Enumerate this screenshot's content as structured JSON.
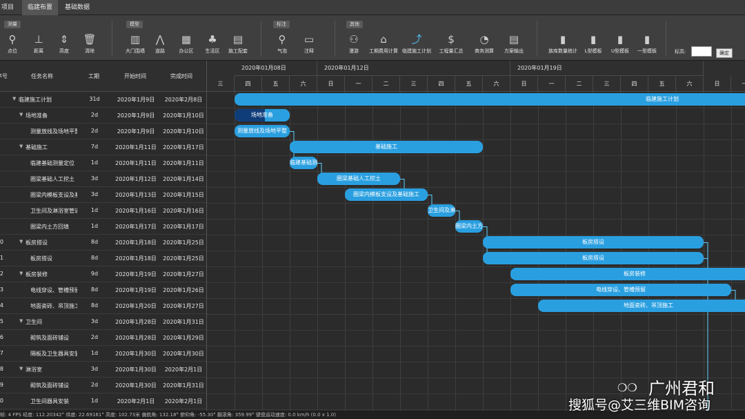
{
  "menu": [
    "项目",
    "临建布置",
    "基础数据"
  ],
  "toolbar": {
    "groups": [
      "测量",
      "模型",
      "标注",
      "其他"
    ],
    "tools": [
      {
        "label": "点位",
        "icon": "location-pin-icon",
        "glyph": "⚲"
      },
      {
        "label": "距离",
        "icon": "ruler-icon",
        "glyph": "⊥"
      },
      {
        "label": "高度",
        "icon": "height-icon",
        "glyph": "⇕"
      },
      {
        "label": "清除",
        "icon": "trash-icon",
        "glyph": "🗑"
      },
      {
        "label": "大门围墙",
        "icon": "gate-icon",
        "glyph": "▥"
      },
      {
        "label": "道路",
        "icon": "road-icon",
        "glyph": "⋀"
      },
      {
        "label": "办公区",
        "icon": "office-icon",
        "glyph": "▦"
      },
      {
        "label": "生活区",
        "icon": "plant-icon",
        "glyph": "♣"
      },
      {
        "label": "施工配套",
        "icon": "facility-icon",
        "glyph": "▤"
      },
      {
        "label": "气泡",
        "icon": "bubble-icon",
        "glyph": "⚲"
      },
      {
        "label": "注释",
        "icon": "comment-icon",
        "glyph": "▭"
      },
      {
        "label": "漫游",
        "icon": "walk-icon",
        "glyph": "⚇"
      },
      {
        "label": "工期费用计算",
        "icon": "home-icon",
        "glyph": "⌂"
      },
      {
        "label": "临建施工计划",
        "icon": "trend-chart-icon",
        "glyph": "⤴"
      },
      {
        "label": "工程量汇总",
        "icon": "coin-icon",
        "glyph": "$"
      },
      {
        "label": "商务测算",
        "icon": "pie-icon",
        "glyph": "◔"
      },
      {
        "label": "方案输出",
        "icon": "document-icon",
        "glyph": "▤"
      },
      {
        "label": "族库数量统计",
        "icon": "stats-icon",
        "glyph": "▮"
      },
      {
        "label": "L型模板",
        "icon": "l-template-icon",
        "glyph": "▮"
      },
      {
        "label": "U型模板",
        "icon": "u-template-icon",
        "glyph": "▮"
      },
      {
        "label": "一型模板",
        "icon": "i-template-icon",
        "glyph": "▮"
      }
    ],
    "elevation_label": "标高:",
    "elevation_value": "",
    "ok_label": "确定"
  },
  "grid": {
    "headers": {
      "id": "序号",
      "name": "任务名称",
      "duration": "工期",
      "start": "开始时间",
      "finish": "完成时间"
    },
    "rows": [
      {
        "id": "",
        "caret": "▼",
        "name": "临建施工计划",
        "duration": "31d",
        "start": "2020年1月9日",
        "finish": "2020年2月8日",
        "level": 0
      },
      {
        "id": "",
        "caret": "▼",
        "name": "场地准备",
        "duration": "2d",
        "start": "2020年1月9日",
        "finish": "2020年1月10日",
        "level": 1
      },
      {
        "id": "",
        "caret": "",
        "name": "测量放线及场地平整",
        "duration": "2d",
        "start": "2020年1月9日",
        "finish": "2020年1月10日",
        "level": 2
      },
      {
        "id": "",
        "caret": "▼",
        "name": "基础施工",
        "duration": "7d",
        "start": "2020年1月11日",
        "finish": "2020年1月17日",
        "level": 1
      },
      {
        "id": "",
        "caret": "",
        "name": "临建基础测量定位",
        "duration": "1d",
        "start": "2020年1月11日",
        "finish": "2020年1月11日",
        "level": 2
      },
      {
        "id": "",
        "caret": "",
        "name": "圈梁基础人工挖土",
        "duration": "3d",
        "start": "2020年1月12日",
        "finish": "2020年1月14日",
        "level": 2
      },
      {
        "id": "",
        "caret": "",
        "name": "圈梁内模板支设及基础施工",
        "duration": "3d",
        "start": "2020年1月13日",
        "finish": "2020年1月15日",
        "level": 2
      },
      {
        "id": "",
        "caret": "",
        "name": "卫生间及淋浴室管道",
        "duration": "1d",
        "start": "2020年1月16日",
        "finish": "2020年1月16日",
        "level": 2
      },
      {
        "id": "",
        "caret": "",
        "name": "圈梁内土方回填",
        "duration": "1d",
        "start": "2020年1月17日",
        "finish": "2020年1月17日",
        "level": 2
      },
      {
        "id": "0",
        "caret": "▼",
        "name": "板房搭设",
        "duration": "8d",
        "start": "2020年1月18日",
        "finish": "2020年1月25日",
        "level": 1
      },
      {
        "id": "1",
        "caret": "",
        "name": "板房搭设",
        "duration": "8d",
        "start": "2020年1月18日",
        "finish": "2020年1月25日",
        "level": 2
      },
      {
        "id": "2",
        "caret": "▼",
        "name": "板房装修",
        "duration": "9d",
        "start": "2020年1月19日",
        "finish": "2020年1月27日",
        "level": 1
      },
      {
        "id": "3",
        "caret": "",
        "name": "电线穿设、管槽预留",
        "duration": "8d",
        "start": "2020年1月19日",
        "finish": "2020年1月26日",
        "level": 2
      },
      {
        "id": "4",
        "caret": "",
        "name": "地面瓷砖、吊顶施工",
        "duration": "8d",
        "start": "2020年1月20日",
        "finish": "2020年1月27日",
        "level": 2
      },
      {
        "id": "5",
        "caret": "▼",
        "name": "卫生间",
        "duration": "3d",
        "start": "2020年1月28日",
        "finish": "2020年1月31日",
        "level": 1
      },
      {
        "id": "6",
        "caret": "",
        "name": "砌筑及面砖铺设",
        "duration": "2d",
        "start": "2020年1月28日",
        "finish": "2020年1月29日",
        "level": 2
      },
      {
        "id": "7",
        "caret": "",
        "name": "隔板及卫生器具安装",
        "duration": "1d",
        "start": "2020年1月30日",
        "finish": "2020年1月30日",
        "level": 2
      },
      {
        "id": "8",
        "caret": "▼",
        "name": "淋浴室",
        "duration": "3d",
        "start": "2020年1月30日",
        "finish": "2020年2月1日",
        "level": 1
      },
      {
        "id": "9",
        "caret": "",
        "name": "砌筑及面砖铺设",
        "duration": "2d",
        "start": "2020年1月30日",
        "finish": "2020年1月31日",
        "level": 2
      },
      {
        "id": "0",
        "caret": "",
        "name": "卫生间器具安装",
        "duration": "1d",
        "start": "2020年2月1日",
        "finish": "2020年2月1日",
        "level": 2
      }
    ]
  },
  "timeline": {
    "weeks": [
      "2020年01月08日",
      "2020年01月12日",
      "2020年01月19日"
    ],
    "days": [
      "三",
      "四",
      "五",
      "六",
      "日",
      "一",
      "二",
      "三",
      "四",
      "五",
      "六",
      "日",
      "一",
      "二",
      "三",
      "四",
      "五",
      "六",
      "日",
      "一"
    ],
    "first_day": 8
  },
  "bars": [
    {
      "row": 0,
      "start": 9,
      "end": 40,
      "label": "临建施工计划"
    },
    {
      "row": 1,
      "start": 9,
      "end": 11,
      "label": "场地准备",
      "progress": 0.55
    },
    {
      "row": 2,
      "start": 9,
      "end": 11,
      "label": "测量放线及场地平整"
    },
    {
      "row": 3,
      "start": 11,
      "end": 18,
      "label": "基础施工"
    },
    {
      "row": 4,
      "start": 11,
      "end": 12,
      "label": "临建基础测"
    },
    {
      "row": 5,
      "start": 12,
      "end": 15,
      "label": "圈梁基础人工挖土"
    },
    {
      "row": 6,
      "start": 13,
      "end": 16,
      "label": "圈梁内模板支设及基础施工"
    },
    {
      "row": 7,
      "start": 16,
      "end": 17,
      "label": "卫生间及淋"
    },
    {
      "row": 8,
      "start": 17,
      "end": 18,
      "label": "圈梁内土方"
    },
    {
      "row": 9,
      "start": 18,
      "end": 26,
      "label": "板房搭设"
    },
    {
      "row": 10,
      "start": 18,
      "end": 26,
      "label": "板房搭设"
    },
    {
      "row": 11,
      "start": 19,
      "end": 28,
      "label": "板房装修"
    },
    {
      "row": 12,
      "start": 19,
      "end": 27,
      "label": "电线穿设、管槽预留"
    },
    {
      "row": 13,
      "start": 20,
      "end": 28,
      "label": "地面瓷砖、吊顶施工"
    }
  ],
  "status": "帧: 4 FPS 经度: 112.20342° 纬度: 22.69161° 高度: 102.73米 偏航角: 132.18° 俯仰角: -55.30° 翻滚角: 359.99° 键盘运动速度: 0.0 km/h (0.0 x 1.0)",
  "watermark": {
    "brand": "广州君和",
    "source": "搜狐号@艾三维BIM咨询"
  }
}
